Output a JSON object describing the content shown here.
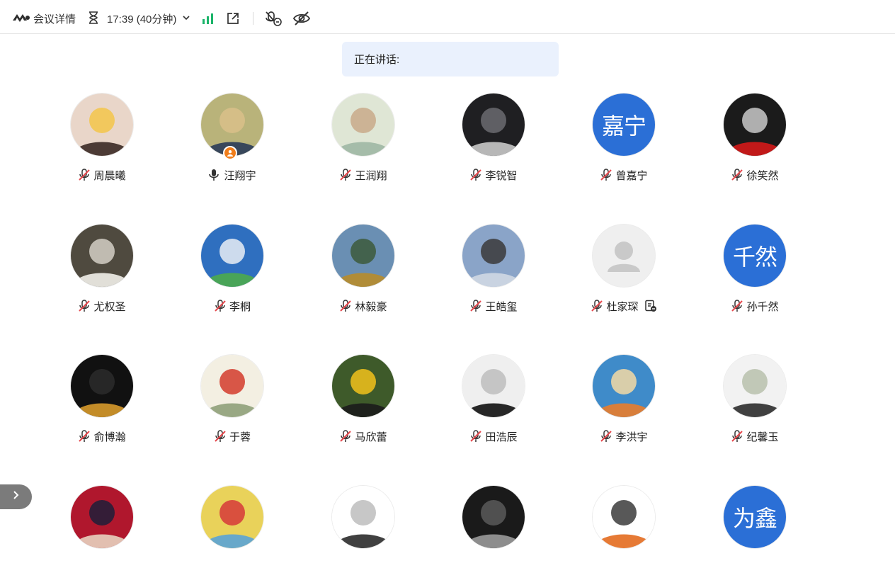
{
  "toolbar": {
    "logo_icon": "tencent-meeting-logo-icon",
    "meeting_details_label": "会议详情",
    "timer_icon": "hourglass-icon",
    "time_label": "17:39 (40分钟)",
    "dropdown_icon": "chevron-down-icon",
    "signal_icon": "network-signal-icon",
    "share_icon": "external-link-icon",
    "mute_all_icon": "mute-all-icon",
    "hide_video_icon": "eye-off-icon",
    "signal_color": "#1bb46a"
  },
  "speaking": {
    "label": "正在讲话:"
  },
  "colors": {
    "accent_blue": "#2b6fd6",
    "mute_red": "#e5484d",
    "host_orange": "#f07d1a"
  },
  "participants": [
    {
      "name": "周晨曦",
      "avatar": "photo",
      "mic": "muted"
    },
    {
      "name": "汪翔宇",
      "avatar": "photo",
      "mic": "on",
      "host": true
    },
    {
      "name": "王润翔",
      "avatar": "photo",
      "mic": "muted"
    },
    {
      "name": "李锐智",
      "avatar": "photo",
      "mic": "muted"
    },
    {
      "name": "曾嘉宁",
      "avatar": "text",
      "avatar_text": "嘉宁",
      "mic": "muted"
    },
    {
      "name": "徐笑然",
      "avatar": "photo",
      "mic": "muted"
    },
    {
      "name": "尤权圣",
      "avatar": "photo",
      "mic": "muted"
    },
    {
      "name": "李桐",
      "avatar": "photo",
      "mic": "muted"
    },
    {
      "name": "林毅豪",
      "avatar": "photo",
      "mic": "muted"
    },
    {
      "name": "王皓玺",
      "avatar": "photo",
      "mic": "muted"
    },
    {
      "name": "杜家琛",
      "avatar": "default",
      "mic": "muted",
      "status_icon": "shared-screen-icon"
    },
    {
      "name": "孙千然",
      "avatar": "text",
      "avatar_text": "千然",
      "mic": "muted"
    },
    {
      "name": "俞博瀚",
      "avatar": "photo",
      "mic": "muted"
    },
    {
      "name": "于蓉",
      "avatar": "photo",
      "mic": "muted"
    },
    {
      "name": "马欣蕾",
      "avatar": "photo",
      "mic": "muted"
    },
    {
      "name": "田浩辰",
      "avatar": "photo",
      "mic": "muted"
    },
    {
      "name": "李洪宇",
      "avatar": "photo",
      "mic": "muted"
    },
    {
      "name": "纪馨玉",
      "avatar": "photo",
      "mic": "muted"
    },
    {
      "name": "",
      "avatar": "photo",
      "mic": "hidden"
    },
    {
      "name": "",
      "avatar": "photo",
      "mic": "hidden"
    },
    {
      "name": "",
      "avatar": "photo",
      "mic": "hidden"
    },
    {
      "name": "",
      "avatar": "photo",
      "mic": "hidden"
    },
    {
      "name": "",
      "avatar": "photo",
      "mic": "hidden"
    },
    {
      "name": "",
      "avatar": "text",
      "avatar_text": "为鑫",
      "mic": "hidden"
    }
  ],
  "side_panel": {
    "toggle_icon": "chevron-right-icon"
  }
}
